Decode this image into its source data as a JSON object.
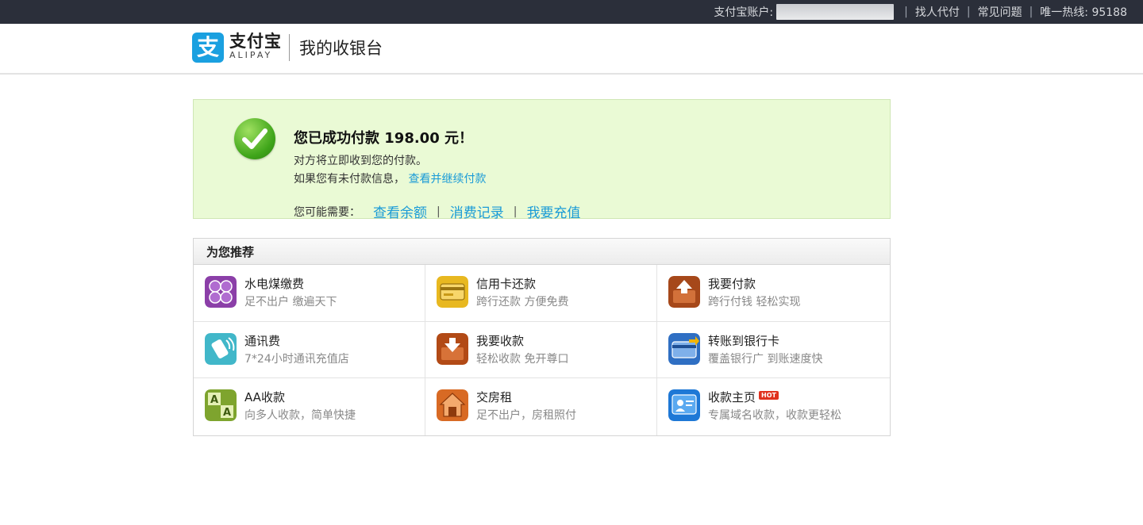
{
  "topbar": {
    "account_label": "支付宝账户:",
    "links": [
      "找人代付",
      "常见问题"
    ],
    "hotline": "唯一热线: 95188"
  },
  "header": {
    "logo_glyph": "支",
    "brand_cn": "支付宝",
    "brand_en": "ALIPAY",
    "title": "我的收银台"
  },
  "success": {
    "title": "您已成功付款 198.00 元！",
    "line1": "对方将立即收到您的付款。",
    "line2_text": "如果您有未付款信息，",
    "line2_link": "查看并继续付款",
    "maybe_label": "您可能需要：",
    "maybe_links": [
      "查看余额",
      "消费记录",
      "我要充值"
    ]
  },
  "recommend": {
    "header": "为您推荐",
    "items": [
      {
        "title": "水电煤缴费",
        "sub": "足不出户  缴遍天下",
        "icon": "utilities-icon"
      },
      {
        "title": "信用卡还款",
        "sub": "跨行还款  方便免费",
        "icon": "credit-card-icon"
      },
      {
        "title": "我要付款",
        "sub": "跨行付钱  轻松实现",
        "icon": "pay-out-icon"
      },
      {
        "title": "通讯费",
        "sub": "7*24小时通讯充值店",
        "icon": "phone-icon"
      },
      {
        "title": "我要收款",
        "sub": "轻松收款  免开尊口",
        "icon": "receive-icon"
      },
      {
        "title": "转账到银行卡",
        "sub": "覆盖银行广  到账速度快",
        "icon": "bank-card-icon"
      },
      {
        "title": "AA收款",
        "sub": "向多人收款，简单快捷",
        "icon": "aa-icon"
      },
      {
        "title": "交房租",
        "sub": "足不出户，房租照付",
        "icon": "house-icon"
      },
      {
        "title": "收款主页",
        "sub": "专属域名收款，收款更轻松",
        "icon": "homepage-icon",
        "badge": "HOT"
      }
    ]
  }
}
